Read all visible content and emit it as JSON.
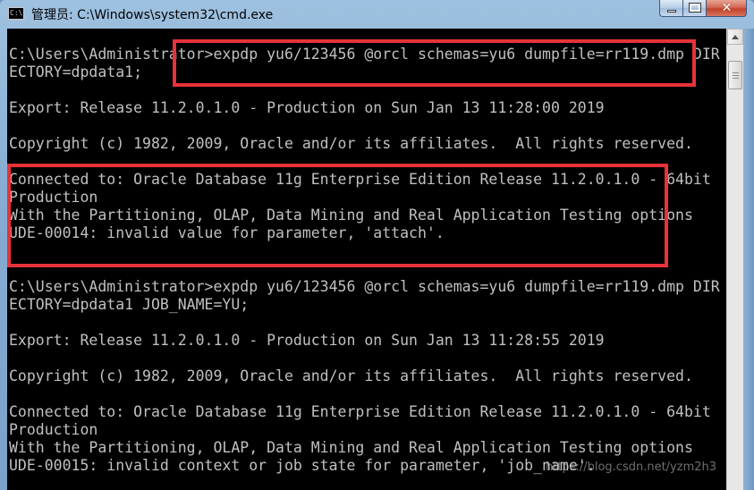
{
  "window": {
    "title": "管理员: C:\\Windows\\system32\\cmd.exe",
    "icon": "cmd-icon",
    "icon_text": "C:\\",
    "buttons": {
      "minimize": "minimize-icon",
      "maximize": "maximize-icon",
      "close": "close-icon",
      "close_glyph": "✕"
    }
  },
  "console": {
    "lines": [
      "C:\\Users\\Administrator>expdp yu6/123456 @orcl schemas=yu6 dumpfile=rr119.dmp DIR",
      "ECTORY=dpdata1;",
      "",
      "Export: Release 11.2.0.1.0 - Production on Sun Jan 13 11:28:00 2019",
      "",
      "Copyright (c) 1982, 2009, Oracle and/or its affiliates.  All rights reserved.",
      "",
      "Connected to: Oracle Database 11g Enterprise Edition Release 11.2.0.1.0 - 64bit",
      "Production",
      "With the Partitioning, OLAP, Data Mining and Real Application Testing options",
      "UDE-00014: invalid value for parameter, 'attach'.",
      "",
      "",
      "C:\\Users\\Administrator>expdp yu6/123456 @orcl schemas=yu6 dumpfile=rr119.dmp DIR",
      "ECTORY=dpdata1 JOB_NAME=YU;",
      "",
      "Export: Release 11.2.0.1.0 - Production on Sun Jan 13 11:28:55 2019",
      "",
      "Copyright (c) 1982, 2009, Oracle and/or its affiliates.  All rights reserved.",
      "",
      "Connected to: Oracle Database 11g Enterprise Edition Release 11.2.0.1.0 - 64bit",
      "Production",
      "With the Partitioning, OLAP, Data Mining and Real Application Testing options",
      "UDE-00015: invalid context or job state for parameter, 'job_name'."
    ]
  },
  "annotations": {
    "highlight_color": "#e8323a"
  },
  "watermark": "https://blog.csdn.net/yzm2h3"
}
